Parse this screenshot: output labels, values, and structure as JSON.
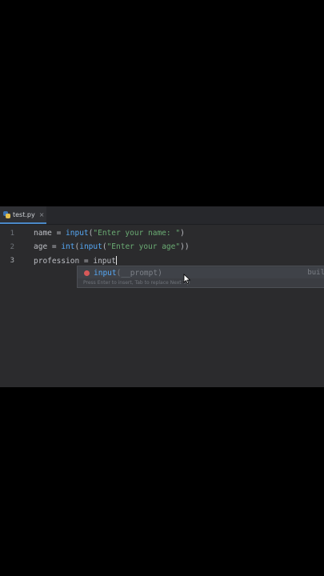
{
  "editor": {
    "tab": {
      "filename": "test.py",
      "close_glyph": "×",
      "icon": "python-file-icon"
    },
    "lines": [
      {
        "number": "1",
        "tokens": [
          "name = ",
          "input",
          "(",
          "\"Enter your name: \"",
          ")"
        ]
      },
      {
        "number": "2",
        "tokens": [
          "age = ",
          "int",
          "(",
          "input",
          "(",
          "\"Enter your age\"",
          "))"
        ]
      },
      {
        "number": "3",
        "tokens": [
          "profession = ",
          "input"
        ]
      }
    ]
  },
  "completion": {
    "icon": "function-icon",
    "name": "input",
    "params": "(__prompt)",
    "type_hint": "buil",
    "hint": "Press Enter to insert, Tab to replace  Next Tip"
  },
  "colors": {
    "editor_bg": "#2b2b2d",
    "function": "#56a8f5",
    "string": "#6aab73",
    "popup_bg": "#3b3d42"
  }
}
